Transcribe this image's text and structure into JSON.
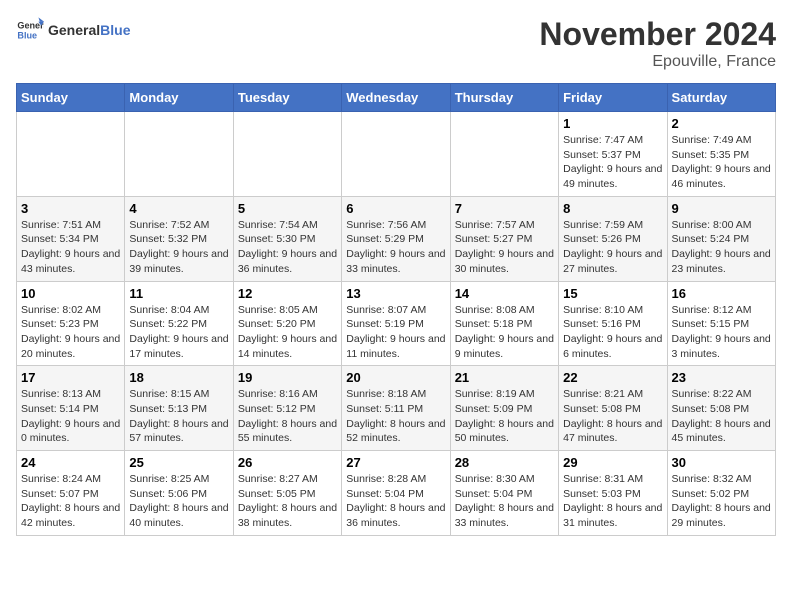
{
  "header": {
    "logo_general": "General",
    "logo_blue": "Blue",
    "month_year": "November 2024",
    "location": "Epouville, France"
  },
  "days_of_week": [
    "Sunday",
    "Monday",
    "Tuesday",
    "Wednesday",
    "Thursday",
    "Friday",
    "Saturday"
  ],
  "weeks": [
    [
      {
        "day": "",
        "info": ""
      },
      {
        "day": "",
        "info": ""
      },
      {
        "day": "",
        "info": ""
      },
      {
        "day": "",
        "info": ""
      },
      {
        "day": "",
        "info": ""
      },
      {
        "day": "1",
        "info": "Sunrise: 7:47 AM\nSunset: 5:37 PM\nDaylight: 9 hours and 49 minutes."
      },
      {
        "day": "2",
        "info": "Sunrise: 7:49 AM\nSunset: 5:35 PM\nDaylight: 9 hours and 46 minutes."
      }
    ],
    [
      {
        "day": "3",
        "info": "Sunrise: 7:51 AM\nSunset: 5:34 PM\nDaylight: 9 hours and 43 minutes."
      },
      {
        "day": "4",
        "info": "Sunrise: 7:52 AM\nSunset: 5:32 PM\nDaylight: 9 hours and 39 minutes."
      },
      {
        "day": "5",
        "info": "Sunrise: 7:54 AM\nSunset: 5:30 PM\nDaylight: 9 hours and 36 minutes."
      },
      {
        "day": "6",
        "info": "Sunrise: 7:56 AM\nSunset: 5:29 PM\nDaylight: 9 hours and 33 minutes."
      },
      {
        "day": "7",
        "info": "Sunrise: 7:57 AM\nSunset: 5:27 PM\nDaylight: 9 hours and 30 minutes."
      },
      {
        "day": "8",
        "info": "Sunrise: 7:59 AM\nSunset: 5:26 PM\nDaylight: 9 hours and 27 minutes."
      },
      {
        "day": "9",
        "info": "Sunrise: 8:00 AM\nSunset: 5:24 PM\nDaylight: 9 hours and 23 minutes."
      }
    ],
    [
      {
        "day": "10",
        "info": "Sunrise: 8:02 AM\nSunset: 5:23 PM\nDaylight: 9 hours and 20 minutes."
      },
      {
        "day": "11",
        "info": "Sunrise: 8:04 AM\nSunset: 5:22 PM\nDaylight: 9 hours and 17 minutes."
      },
      {
        "day": "12",
        "info": "Sunrise: 8:05 AM\nSunset: 5:20 PM\nDaylight: 9 hours and 14 minutes."
      },
      {
        "day": "13",
        "info": "Sunrise: 8:07 AM\nSunset: 5:19 PM\nDaylight: 9 hours and 11 minutes."
      },
      {
        "day": "14",
        "info": "Sunrise: 8:08 AM\nSunset: 5:18 PM\nDaylight: 9 hours and 9 minutes."
      },
      {
        "day": "15",
        "info": "Sunrise: 8:10 AM\nSunset: 5:16 PM\nDaylight: 9 hours and 6 minutes."
      },
      {
        "day": "16",
        "info": "Sunrise: 8:12 AM\nSunset: 5:15 PM\nDaylight: 9 hours and 3 minutes."
      }
    ],
    [
      {
        "day": "17",
        "info": "Sunrise: 8:13 AM\nSunset: 5:14 PM\nDaylight: 9 hours and 0 minutes."
      },
      {
        "day": "18",
        "info": "Sunrise: 8:15 AM\nSunset: 5:13 PM\nDaylight: 8 hours and 57 minutes."
      },
      {
        "day": "19",
        "info": "Sunrise: 8:16 AM\nSunset: 5:12 PM\nDaylight: 8 hours and 55 minutes."
      },
      {
        "day": "20",
        "info": "Sunrise: 8:18 AM\nSunset: 5:11 PM\nDaylight: 8 hours and 52 minutes."
      },
      {
        "day": "21",
        "info": "Sunrise: 8:19 AM\nSunset: 5:09 PM\nDaylight: 8 hours and 50 minutes."
      },
      {
        "day": "22",
        "info": "Sunrise: 8:21 AM\nSunset: 5:08 PM\nDaylight: 8 hours and 47 minutes."
      },
      {
        "day": "23",
        "info": "Sunrise: 8:22 AM\nSunset: 5:08 PM\nDaylight: 8 hours and 45 minutes."
      }
    ],
    [
      {
        "day": "24",
        "info": "Sunrise: 8:24 AM\nSunset: 5:07 PM\nDaylight: 8 hours and 42 minutes."
      },
      {
        "day": "25",
        "info": "Sunrise: 8:25 AM\nSunset: 5:06 PM\nDaylight: 8 hours and 40 minutes."
      },
      {
        "day": "26",
        "info": "Sunrise: 8:27 AM\nSunset: 5:05 PM\nDaylight: 8 hours and 38 minutes."
      },
      {
        "day": "27",
        "info": "Sunrise: 8:28 AM\nSunset: 5:04 PM\nDaylight: 8 hours and 36 minutes."
      },
      {
        "day": "28",
        "info": "Sunrise: 8:30 AM\nSunset: 5:04 PM\nDaylight: 8 hours and 33 minutes."
      },
      {
        "day": "29",
        "info": "Sunrise: 8:31 AM\nSunset: 5:03 PM\nDaylight: 8 hours and 31 minutes."
      },
      {
        "day": "30",
        "info": "Sunrise: 8:32 AM\nSunset: 5:02 PM\nDaylight: 8 hours and 29 minutes."
      }
    ]
  ]
}
